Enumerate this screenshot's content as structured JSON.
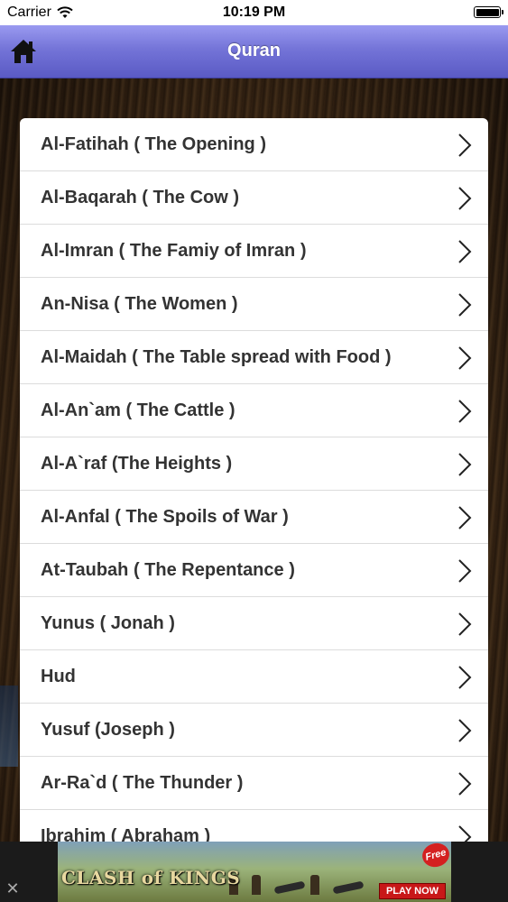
{
  "status_bar": {
    "carrier": "Carrier",
    "time": "10:19 PM",
    "wifi_icon": "wifi-icon",
    "battery_icon": "battery-icon"
  },
  "nav": {
    "title": "Quran",
    "home_icon": "home-icon"
  },
  "surahs": [
    {
      "label": "Al-Fatihah ( The Opening )"
    },
    {
      "label": "Al-Baqarah ( The Cow )"
    },
    {
      "label": "Al-Imran ( The Famiy of Imran )"
    },
    {
      "label": "An-Nisa ( The Women )"
    },
    {
      "label": "Al-Maidah ( The Table spread with Food )"
    },
    {
      "label": "Al-An`am ( The Cattle )"
    },
    {
      "label": "Al-A`raf (The Heights )"
    },
    {
      "label": "Al-Anfal ( The Spoils of War )"
    },
    {
      "label": "At-Taubah ( The Repentance )"
    },
    {
      "label": "Yunus ( Jonah )"
    },
    {
      "label": "Hud"
    },
    {
      "label": "Yusuf (Joseph )"
    },
    {
      "label": "Ar-Ra`d ( The Thunder )"
    },
    {
      "label": "Ibrahim ( Abraham )"
    }
  ],
  "ad": {
    "close_glyph": "✕",
    "logo_text": "CLASH of KINGS",
    "badge": "Free",
    "cta": "PLAY NOW"
  },
  "colors": {
    "nav_top": "#9a9af0",
    "nav_bottom": "#5a5ac4",
    "list_text": "#333333",
    "chevron": "#222222"
  }
}
